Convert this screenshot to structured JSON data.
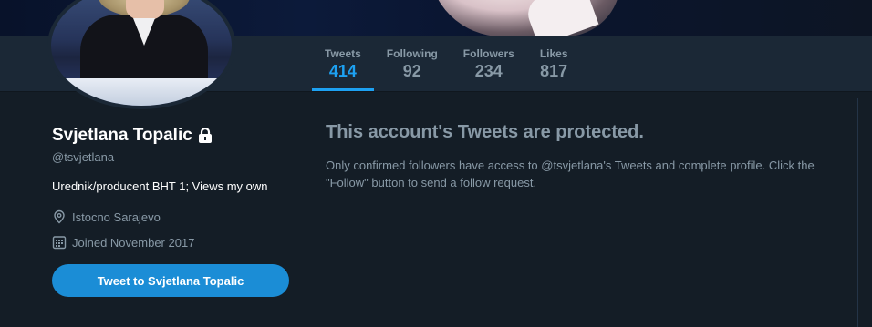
{
  "profile": {
    "name": "Svjetlana Topalic",
    "handle": "@tsvjetlana",
    "bio": "Urednik/producent BHT 1; Views my own",
    "location": "Istocno Sarajevo",
    "joined": "Joined November 2017",
    "tweet_to_label": "Tweet to Svjetlana Topalic"
  },
  "stats": [
    {
      "label": "Tweets",
      "value": "414"
    },
    {
      "label": "Following",
      "value": "92"
    },
    {
      "label": "Followers",
      "value": "234"
    },
    {
      "label": "Likes",
      "value": "817"
    }
  ],
  "protected": {
    "title": "This account's Tweets are protected.",
    "body": "Only confirmed followers have access to @tsvjetlana's Tweets and complete profile. Click the \"Follow\" button to send a follow request."
  },
  "colors": {
    "background": "#141d26",
    "navbar": "#1b2836",
    "accent": "#1da1f2",
    "muted": "#8899a6",
    "button": "#1b8dd6"
  },
  "icons": [
    "lock-icon",
    "location-icon",
    "calendar-icon"
  ]
}
